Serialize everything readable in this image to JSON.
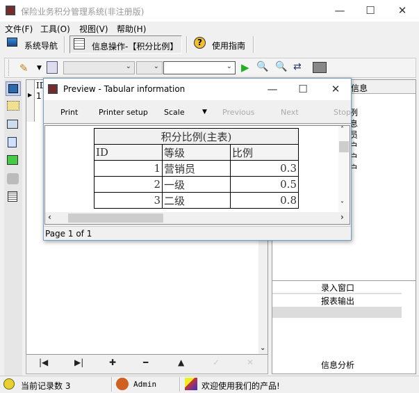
{
  "window": {
    "title": "保险业务积分管理系统(非注册版)",
    "minimize": "—",
    "maximize": "☐",
    "close": "✕"
  },
  "menu": [
    "文件(F)",
    "工具(O)",
    "视图(V)",
    "帮助(H)"
  ],
  "toolbar1": {
    "nav": "系统导航",
    "info": "信息操作-【积分比例】",
    "guide": "使用指南"
  },
  "grid": {
    "header": "ID",
    "first_row": "1"
  },
  "right_panel": {
    "header": "信息",
    "fragments": [
      "例",
      "息",
      "员",
      "户",
      "户",
      "户"
    ],
    "items": [
      "录入窗口",
      "报表输出"
    ],
    "bottom_item": "信息分析"
  },
  "nav_buttons": [
    "|◀",
    "▶|",
    "✚",
    "━",
    "▲",
    "✓",
    "✕"
  ],
  "status": {
    "records": "当前记录数 3",
    "user": "Admin",
    "welcome": "欢迎使用我们的产品!"
  },
  "preview": {
    "title": "Preview - Tabular information",
    "buttons": {
      "print": "Print",
      "printer_setup": "Printer setup",
      "scale": "Scale",
      "previous": "Previous",
      "next": "Next",
      "stop": "Stop"
    },
    "table": {
      "title": "积分比例(主表)",
      "headers": [
        "ID",
        "等级",
        "比例"
      ],
      "rows": [
        [
          "1",
          "营销员",
          "0.3"
        ],
        [
          "2",
          "一级",
          "0.5"
        ],
        [
          "3",
          "二级",
          "0.8"
        ]
      ]
    },
    "page_status": "Page 1 of 1"
  }
}
